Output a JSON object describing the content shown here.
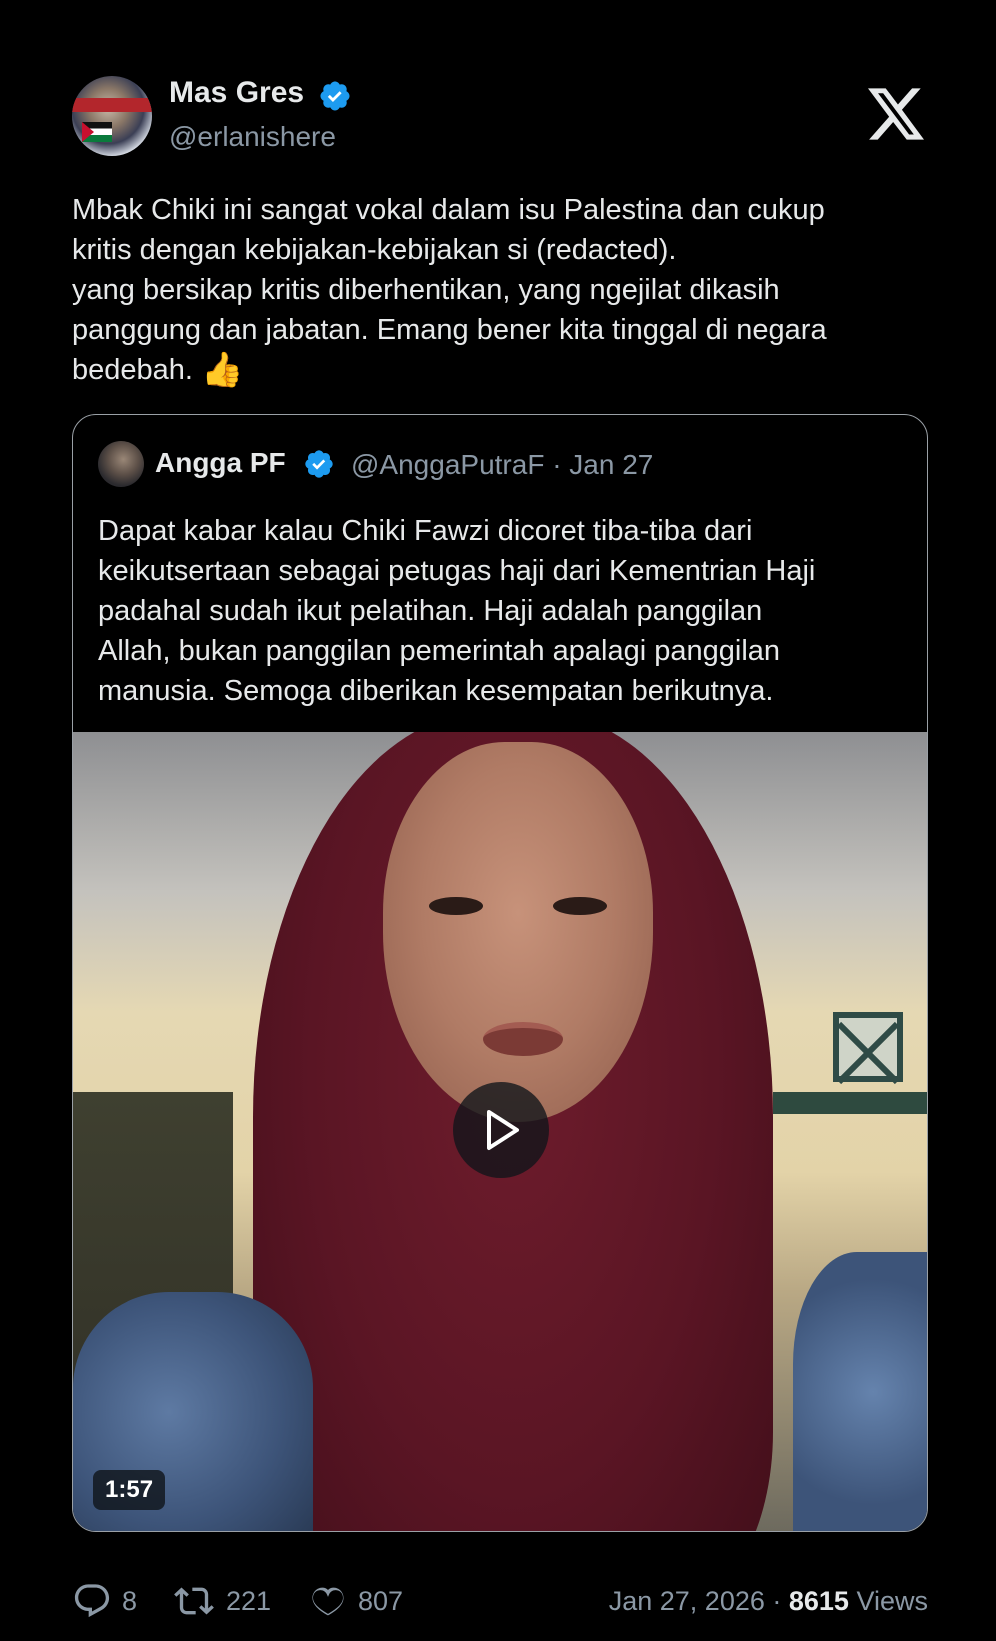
{
  "author": {
    "name": "Mas Gres",
    "handle": "@erlanishere",
    "verified": true
  },
  "tweet": {
    "lines": [
      "Mbak Chiki ini sangat vokal dalam isu Palestina dan cukup",
      "kritis dengan kebijakan-kebijakan si (redacted).",
      "yang bersikap kritis diberhentikan, yang ngejilat dikasih",
      "panggung dan jabatan. Emang bener kita tinggal di negara",
      "bedebah."
    ],
    "emoji": "👍"
  },
  "quote": {
    "name": "Angga PF",
    "handle_date": "@AnggaPutraF · Jan 27",
    "verified": true,
    "lines": [
      "Dapat kabar kalau Chiki Fawzi dicoret tiba-tiba dari",
      "keikutsertaan sebagai petugas haji dari Kementrian Haji",
      "padahal sudah ikut pelatihan. Haji adalah panggilan",
      "Allah, bukan panggilan pemerintah apalagi panggilan",
      "manusia. Semoga diberikan kesempatan berikutnya."
    ],
    "video": {
      "duration": "1:57"
    }
  },
  "metrics": {
    "replies": "8",
    "retweets": "221",
    "likes": "807"
  },
  "meta": {
    "date": "Jan 27, 2026 · ",
    "views_count": "8615",
    "views_label": " Views"
  },
  "colors": {
    "background": "#000000",
    "text": "#e7e9ea",
    "muted": "#8b98a5",
    "verified": "#1d9bf0"
  }
}
